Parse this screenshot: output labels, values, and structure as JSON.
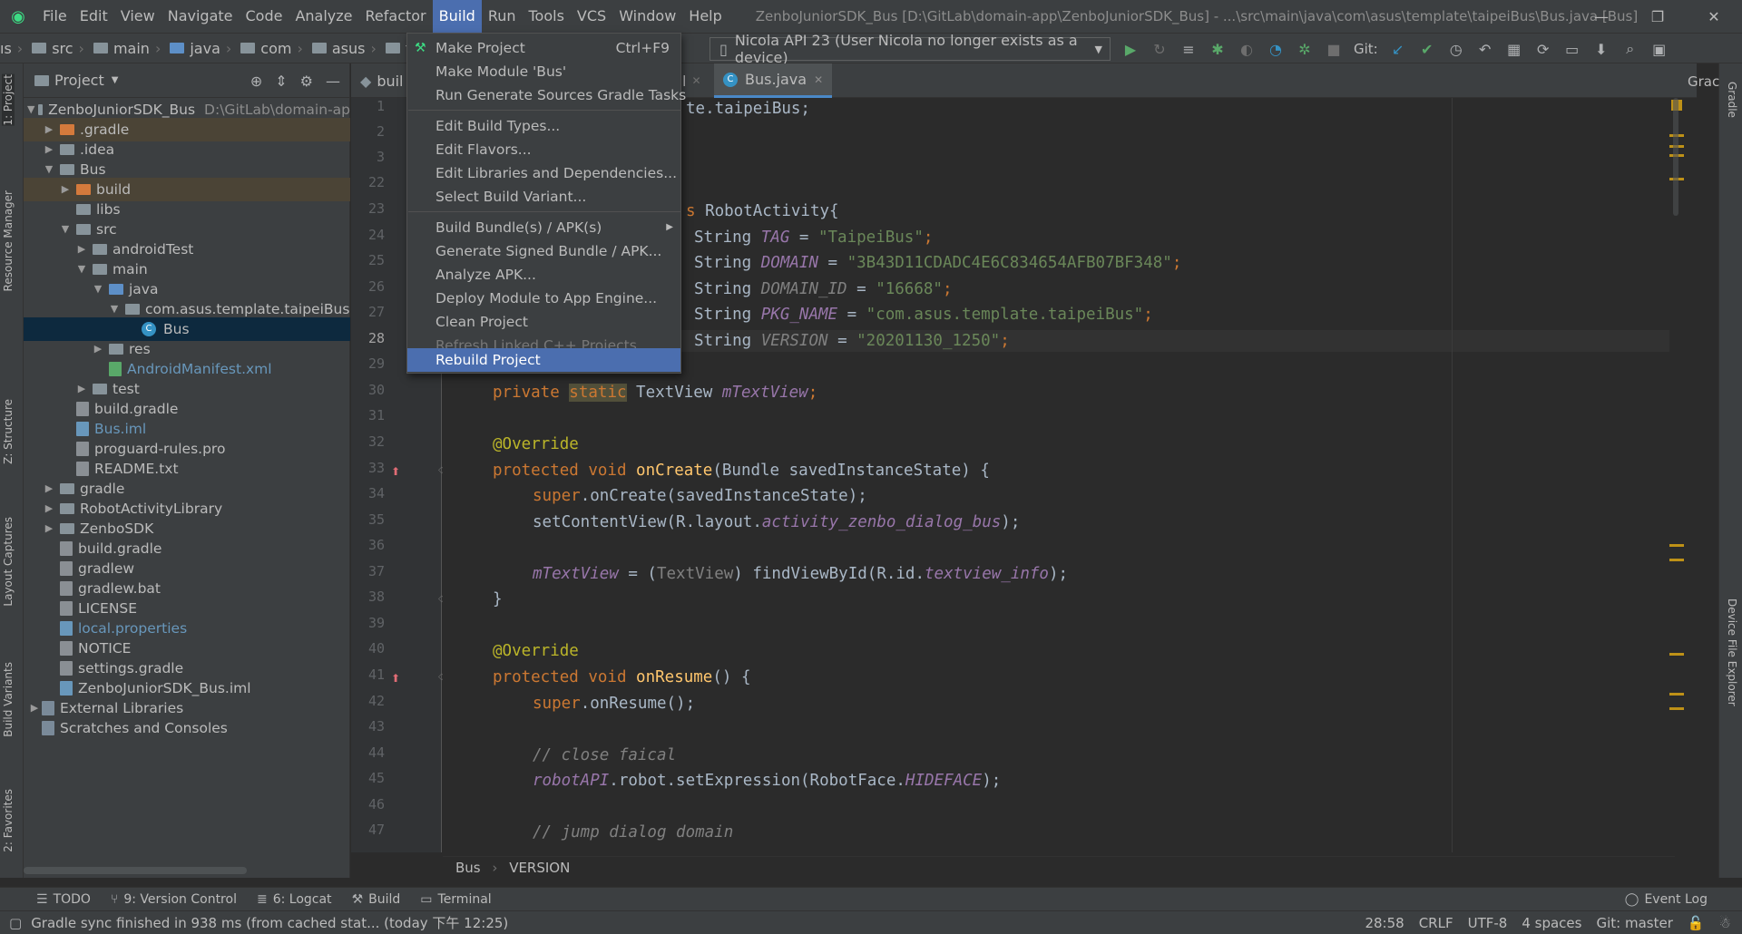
{
  "app": {
    "title": "ZenboJuniorSDK_Bus [D:\\GitLab\\domain-app\\ZenboJuniorSDK_Bus] - ...\\src\\main\\java\\com\\asus\\template\\taipeiBus\\Bus.java [Bus]"
  },
  "menubar": [
    "File",
    "Edit",
    "View",
    "Navigate",
    "Code",
    "Analyze",
    "Refactor",
    "Build",
    "Run",
    "Tools",
    "VCS",
    "Window",
    "Help"
  ],
  "navbar": {
    "crumbs": [
      "ıs",
      "src",
      "main",
      "java",
      "com",
      "asus",
      "template"
    ],
    "run_config": "Nicola API 23 (User Nicola no longer exists as a device)",
    "git_label": "Git:"
  },
  "build_menu": {
    "items": [
      {
        "label": "Make Project",
        "shortcut": "Ctrl+F9"
      },
      {
        "label": "Make Module 'Bus'"
      },
      {
        "label": "Run Generate Sources Gradle Tasks"
      },
      {
        "label": "Edit Build Types..."
      },
      {
        "label": "Edit Flavors..."
      },
      {
        "label": "Edit Libraries and Dependencies..."
      },
      {
        "label": "Select Build Variant..."
      },
      {
        "label": "Build Bundle(s) / APK(s)"
      },
      {
        "label": "Generate Signed Bundle / APK..."
      },
      {
        "label": "Analyze APK..."
      },
      {
        "label": "Deploy Module to App Engine..."
      },
      {
        "label": "Clean Project"
      },
      {
        "label": "Refresh Linked C++ Projects"
      },
      {
        "label": "Rebuild Project"
      }
    ]
  },
  "project_panel": {
    "title": "Project",
    "tree": [
      {
        "label": "ZenboJuniorSDK_Bus",
        "hint": "D:\\GitLab\\domain-ap"
      },
      {
        "label": ".gradle"
      },
      {
        "label": ".idea"
      },
      {
        "label": "Bus"
      },
      {
        "label": "build"
      },
      {
        "label": "libs"
      },
      {
        "label": "src"
      },
      {
        "label": "androidTest"
      },
      {
        "label": "main"
      },
      {
        "label": "java"
      },
      {
        "label": "com.asus.template.taipeiBus"
      },
      {
        "label": "Bus"
      },
      {
        "label": "res"
      },
      {
        "label": "AndroidManifest.xml"
      },
      {
        "label": "test"
      },
      {
        "label": "build.gradle"
      },
      {
        "label": "Bus.iml"
      },
      {
        "label": "proguard-rules.pro"
      },
      {
        "label": "README.txt"
      },
      {
        "label": "gradle"
      },
      {
        "label": "RobotActivityLibrary"
      },
      {
        "label": "ZenboSDK"
      },
      {
        "label": "build.gradle"
      },
      {
        "label": "gradlew"
      },
      {
        "label": "gradlew.bat"
      },
      {
        "label": "LICENSE"
      },
      {
        "label": "local.properties"
      },
      {
        "label": "NOTICE"
      },
      {
        "label": "settings.gradle"
      },
      {
        "label": "ZenboJuniorSDK_Bus.iml"
      },
      {
        "label": "External Libraries"
      },
      {
        "label": "Scratches and Consoles"
      }
    ]
  },
  "editor": {
    "tabs": [
      "buil",
      "l",
      "Bus.java"
    ],
    "line_numbers": [
      "1",
      "2",
      "3",
      "22",
      "23",
      "24",
      "25",
      "26",
      "27",
      "28",
      "29",
      "30",
      "31",
      "32",
      "33",
      "34",
      "35",
      "36",
      "37",
      "38",
      "39",
      "40",
      "41",
      "42",
      "43",
      "44",
      "45",
      "46",
      "47"
    ],
    "code": {
      "l1": "te.taipeiBus;",
      "l23_a": "s ",
      "l23_b": "RobotActivity{",
      "l24_a": "String ",
      "l24_b": "TAG",
      "l24_c": " = ",
      "l24_d": "\"TaipeiBus\"",
      "l25_b": "DOMAIN",
      "l25_d": "\"3B43D11CDADC4E6C834654AFB07BF348\"",
      "l26_b": "DOMAIN_ID",
      "l26_d": "\"16668\"",
      "l27_b": "PKG_NAME",
      "l27_d": "\"com.asus.template.taipeiBus\"",
      "l28_b": "VERSION",
      "l28_d": "\"20201130_1250\"",
      "semi": ";",
      "l30_a": "private ",
      "l30_b": "static",
      "l30_c": " TextView ",
      "l30_d": "mTextView",
      "override": "@Override",
      "l33_a": "protected void ",
      "l33_b": "onCreate",
      "l33_c": "(Bundle savedInstanceState) {",
      "l34_a": "super",
      "l34_b": ".onCreate(savedInstanceState);",
      "l35_a": "setContentView(R.layout.",
      "l35_b": "activity_zenbo_dialog_bus",
      "l35_c": ");",
      "l37_a": "mTextView",
      "l37_b": " = (",
      "l37_c": "TextView",
      "l37_d": ") findViewById(R.id.",
      "l37_e": "textview_info",
      "l37_f": ");",
      "close_brace": "}",
      "l41_b": "onResume",
      "l41_c": "() {",
      "l42_b": ".onResume();",
      "l44": "// close faical",
      "l45_a": "robotAPI",
      "l45_b": ".robot.setExpression(RobotFace.",
      "l45_c": "HIDEFACE",
      "l45_d": ");",
      "l47": "// jump dialog domain"
    },
    "breadcrumb": [
      "Bus",
      "VERSION"
    ]
  },
  "side_tabs": {
    "left": [
      "1: Project",
      "Resource Manager",
      "Z: Structure",
      "Layout Captures",
      "Build Variants",
      "2: Favorites"
    ],
    "right": [
      "Gradle",
      "Device File Explorer"
    ],
    "right_top": "Grac"
  },
  "bottom_tabs": [
    "TODO",
    "9: Version Control",
    "6: Logcat",
    "Build",
    "Terminal"
  ],
  "event_log": "Event Log",
  "status": {
    "message": "Gradle sync finished in 938 ms (from cached stat... (today 下午 12:25)",
    "position": "28:58",
    "line_sep": "CRLF",
    "encoding": "UTF-8",
    "indent": "4 spaces",
    "vcs": "Git: master"
  }
}
